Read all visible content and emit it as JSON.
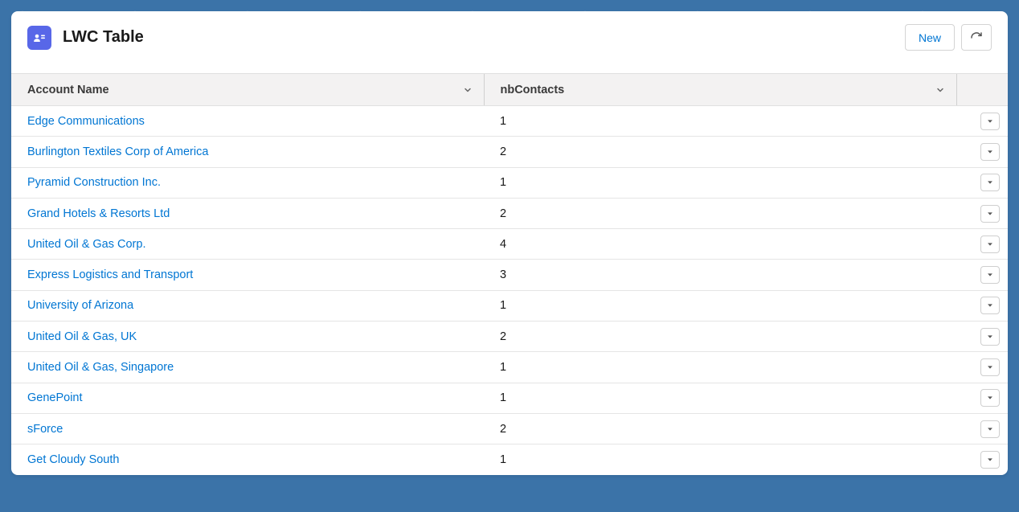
{
  "header": {
    "title": "LWC Table",
    "new_label": "New"
  },
  "columns": {
    "name": "Account Name",
    "contacts": "nbContacts"
  },
  "rows": [
    {
      "name": "Edge Communications",
      "contacts": "1"
    },
    {
      "name": "Burlington Textiles Corp of America",
      "contacts": "2"
    },
    {
      "name": "Pyramid Construction Inc.",
      "contacts": "1"
    },
    {
      "name": "Grand Hotels & Resorts Ltd",
      "contacts": "2"
    },
    {
      "name": "United Oil & Gas Corp.",
      "contacts": "4"
    },
    {
      "name": "Express Logistics and Transport",
      "contacts": "3"
    },
    {
      "name": "University of Arizona",
      "contacts": "1"
    },
    {
      "name": "United Oil & Gas, UK",
      "contacts": "2"
    },
    {
      "name": "United Oil & Gas, Singapore",
      "contacts": "1"
    },
    {
      "name": "GenePoint",
      "contacts": "1"
    },
    {
      "name": "sForce",
      "contacts": "2"
    },
    {
      "name": "Get Cloudy South",
      "contacts": "1"
    }
  ]
}
